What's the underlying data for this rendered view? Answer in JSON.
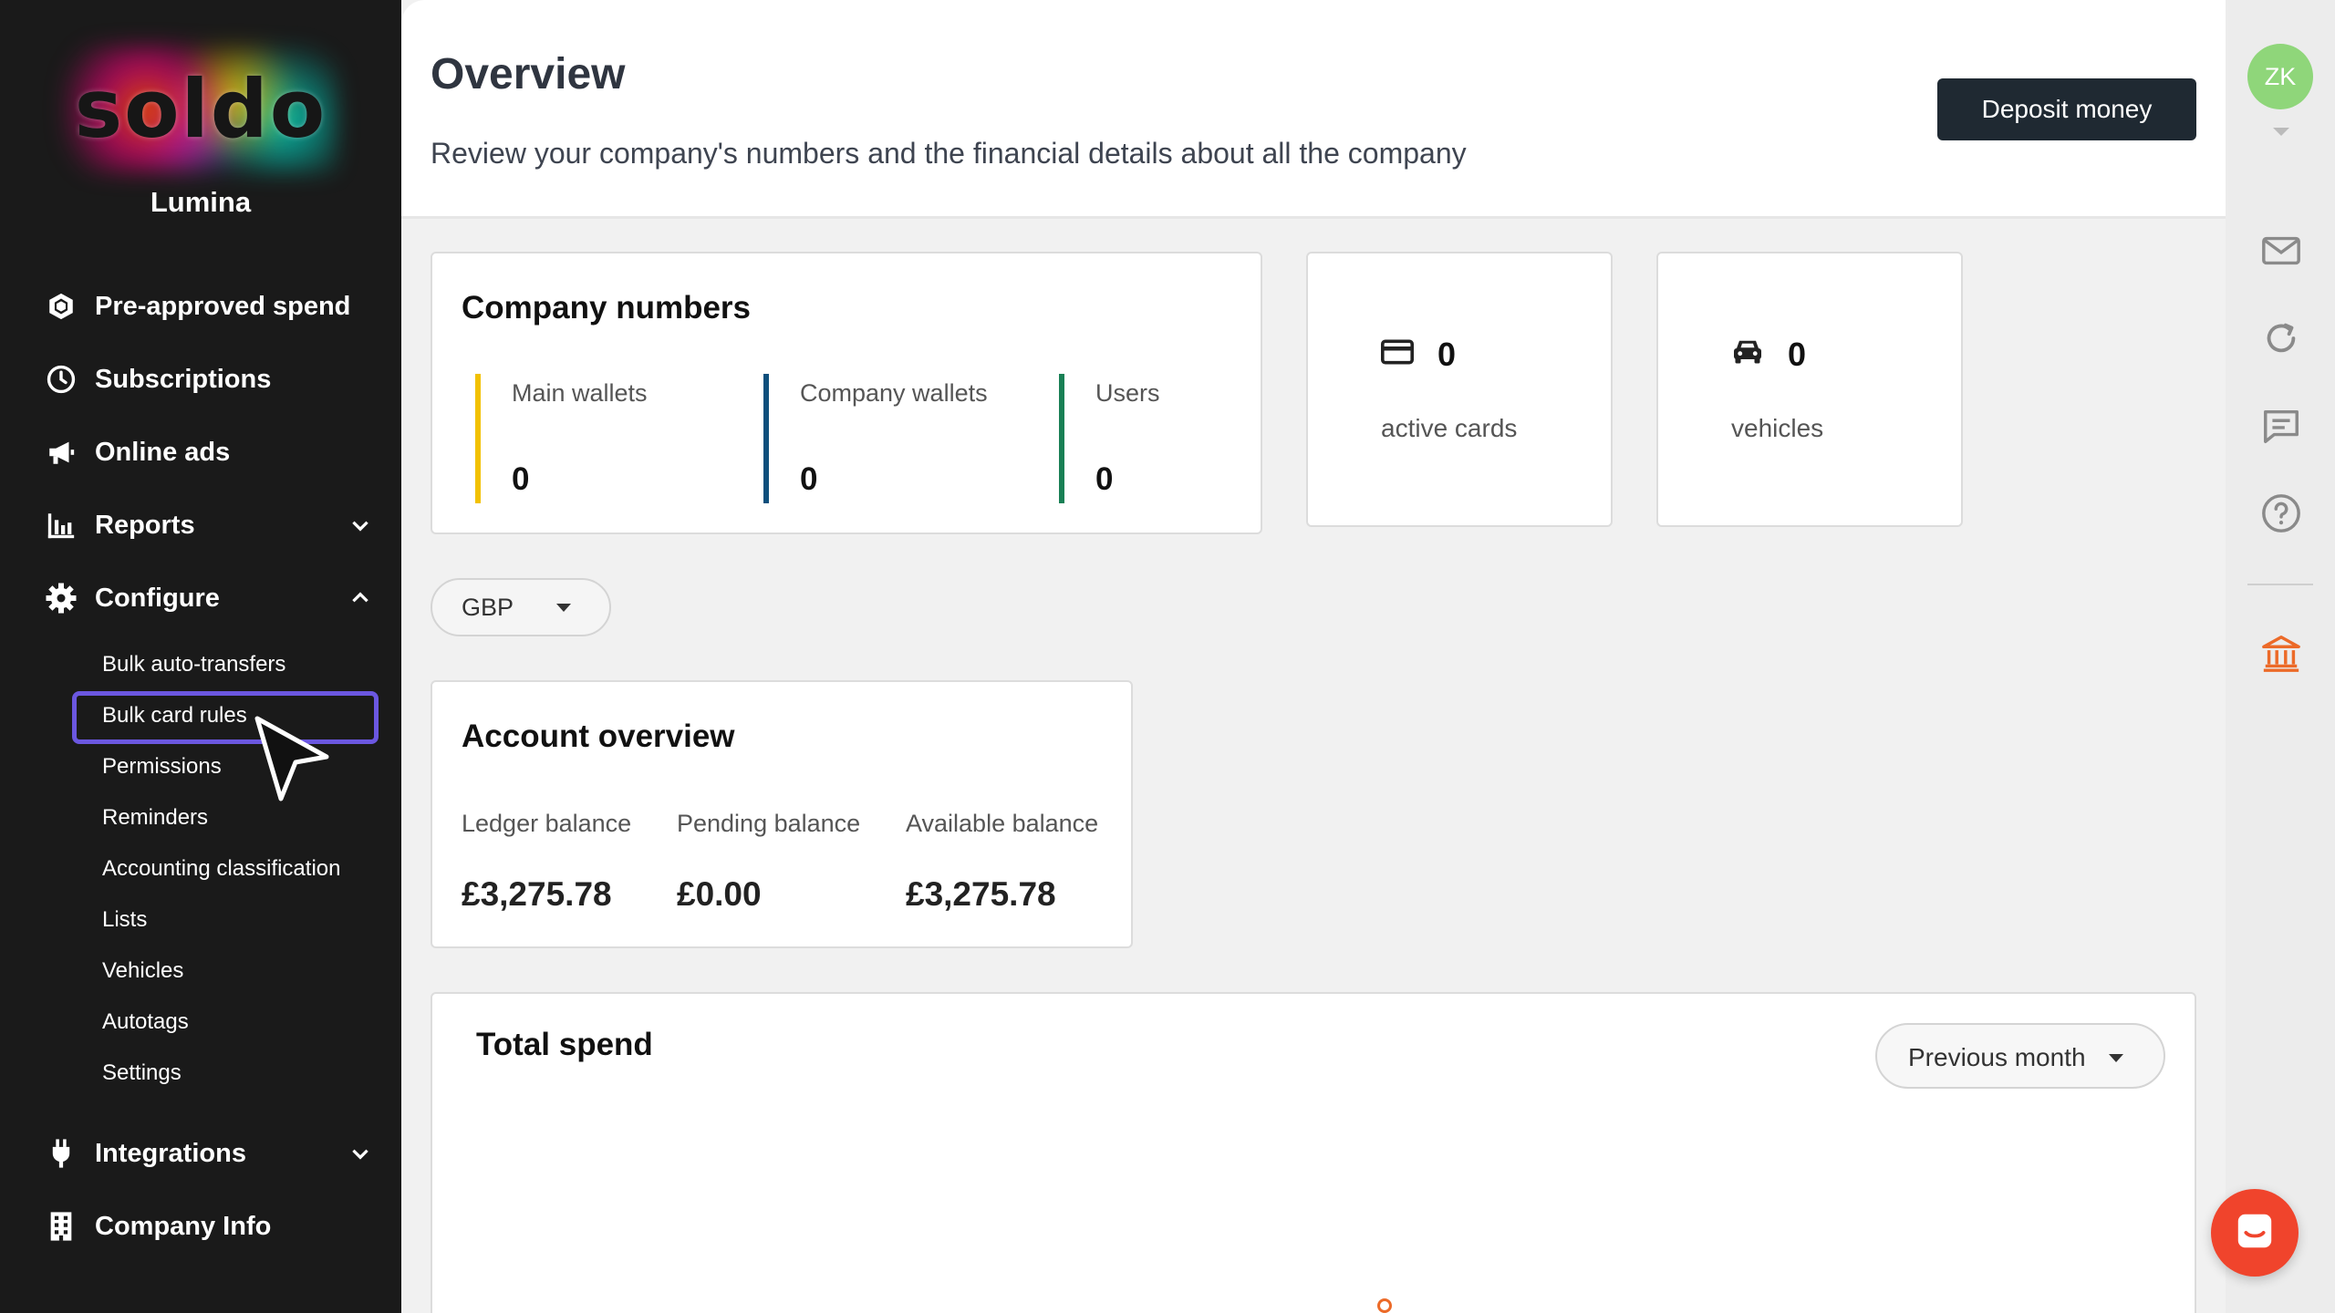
{
  "brand": {
    "logo_text": "soldo",
    "company_name": "Lumina"
  },
  "sidebar": {
    "items": [
      {
        "label": "Pre-approved spend",
        "icon": "shield-icon"
      },
      {
        "label": "Subscriptions",
        "icon": "clock-icon"
      },
      {
        "label": "Online ads",
        "icon": "megaphone-icon"
      },
      {
        "label": "Reports",
        "icon": "bar-chart-icon",
        "chevron": "down"
      },
      {
        "label": "Configure",
        "icon": "gear-icon",
        "chevron": "up"
      },
      {
        "label": "Integrations",
        "icon": "plug-icon",
        "chevron": "down"
      },
      {
        "label": "Company Info",
        "icon": "building-icon"
      }
    ],
    "configure_subitems": [
      "Bulk auto-transfers",
      "Bulk card rules",
      "Permissions",
      "Reminders",
      "Accounting classification",
      "Lists",
      "Vehicles",
      "Autotags",
      "Settings"
    ],
    "highlighted_subitem": "Bulk card rules",
    "highlight_color": "#6b57e0"
  },
  "header": {
    "title": "Overview",
    "subtitle": "Review your company's numbers and the financial details about all the company",
    "deposit_button": "Deposit money"
  },
  "company_numbers": {
    "title": "Company numbers",
    "stats": [
      {
        "label": "Main wallets",
        "value": "0",
        "color": "#f2c100"
      },
      {
        "label": "Company wallets",
        "value": "0",
        "color": "#0d4f7c"
      },
      {
        "label": "Users",
        "value": "0",
        "color": "#198055"
      }
    ]
  },
  "active_cards": {
    "value": "0",
    "label": "active cards",
    "icon": "card-icon"
  },
  "vehicles": {
    "value": "0",
    "label": "vehicles",
    "icon": "car-icon"
  },
  "currency": {
    "selected": "GBP"
  },
  "account_overview": {
    "title": "Account overview",
    "balances": [
      {
        "label": "Ledger balance",
        "value": "£3,275.78"
      },
      {
        "label": "Pending balance",
        "value": "£0.00"
      },
      {
        "label": "Available balance",
        "value": "£3,275.78"
      }
    ]
  },
  "total_spend": {
    "title": "Total spend",
    "period": "Previous month"
  },
  "user": {
    "initials": "ZK",
    "avatar_color": "#8fd67a"
  },
  "rail_icons": [
    "mail-icon",
    "refresh-icon",
    "message-icon",
    "help-icon",
    "bank-icon"
  ],
  "colors": {
    "accent_orange": "#ec6a28",
    "chat_button": "#f0442c",
    "sidebar_bg": "#1a1a1a"
  }
}
